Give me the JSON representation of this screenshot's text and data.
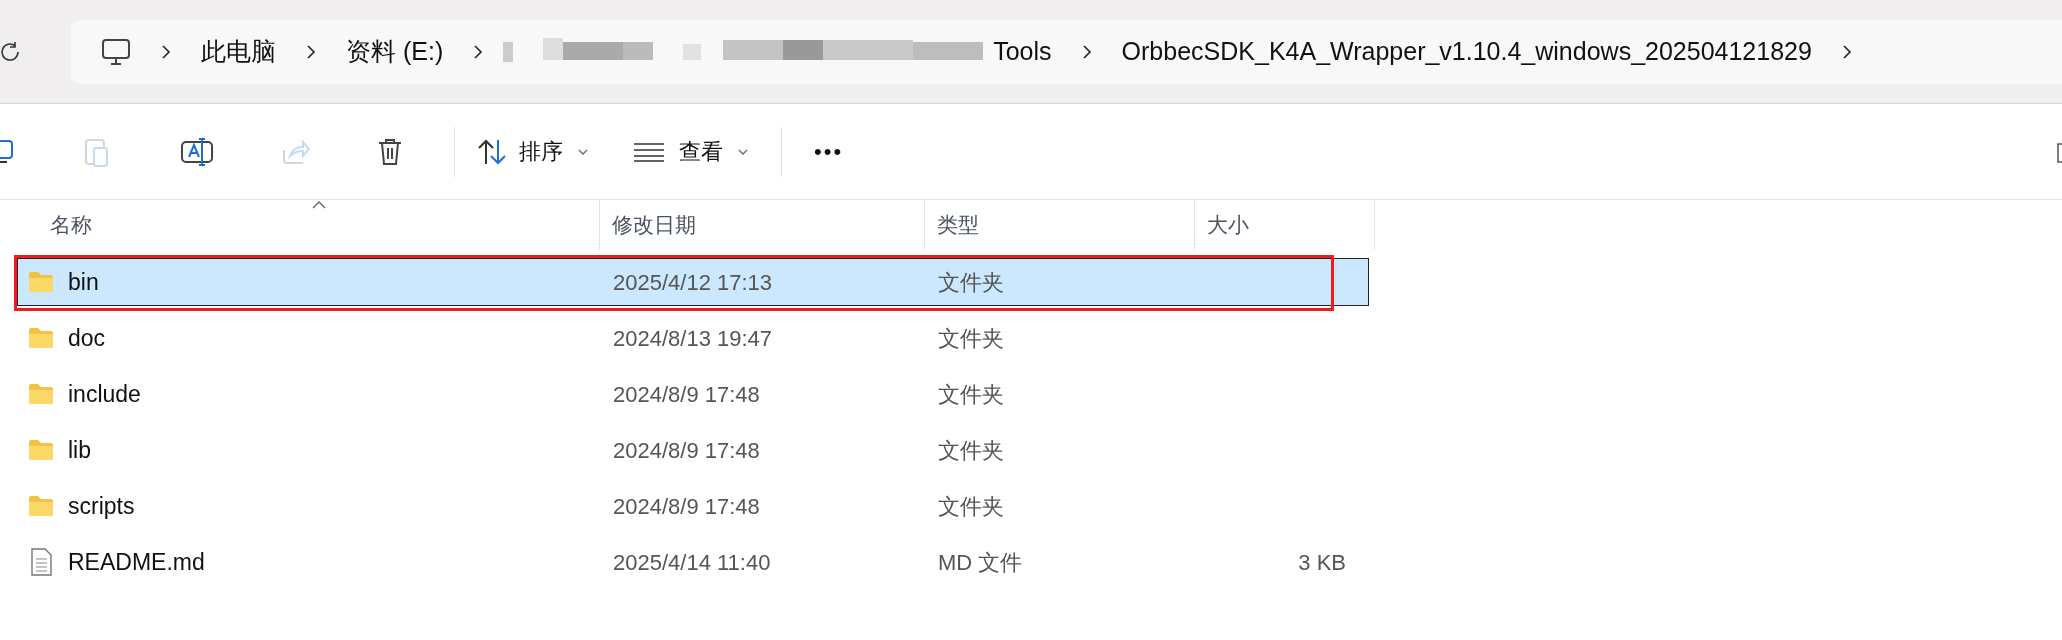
{
  "breadcrumb": {
    "items": [
      {
        "kind": "computer"
      },
      {
        "kind": "text",
        "label": "此电脑"
      },
      {
        "kind": "text",
        "label": "资料 (E:)"
      },
      {
        "kind": "redacted",
        "label": "Tools"
      },
      {
        "kind": "text",
        "label": "OrbbecSDK_K4A_Wrapper_v1.10.4_windows_202504121829"
      }
    ]
  },
  "toolbar": {
    "items": [
      {
        "kind": "copy",
        "disabled": false
      },
      {
        "kind": "paste",
        "disabled": true
      },
      {
        "kind": "rename",
        "disabled": false
      },
      {
        "kind": "share",
        "disabled": true
      },
      {
        "kind": "delete",
        "disabled": false
      },
      {
        "kind": "divider"
      },
      {
        "kind": "sort",
        "label": "排序"
      },
      {
        "kind": "view",
        "label": "查看"
      },
      {
        "kind": "divider"
      },
      {
        "kind": "more",
        "label": "•••"
      }
    ]
  },
  "table": {
    "columns": [
      {
        "label": "名称",
        "sorted": true
      },
      {
        "label": "修改日期",
        "sorted": false
      },
      {
        "label": "类型",
        "sorted": false
      },
      {
        "label": "大小",
        "sorted": false
      }
    ],
    "rows": [
      {
        "kind": "folder",
        "name": "bin",
        "modified": "2025/4/12 17:13",
        "type": "文件夹",
        "selected": true,
        "highlighted": true
      },
      {
        "kind": "folder",
        "name": "doc",
        "modified": "2024/8/13 19:47",
        "type": "文件夹",
        "selected": false,
        "highlighted": false
      },
      {
        "kind": "folder",
        "name": "include",
        "modified": "2024/8/9 17:48",
        "type": "文件夹",
        "selected": false,
        "highlighted": false
      },
      {
        "kind": "folder",
        "name": "lib",
        "modified": "2024/8/9 17:48",
        "type": "文件夹",
        "selected": false,
        "highlighted": false
      },
      {
        "kind": "folder",
        "name": "scripts",
        "modified": "2024/8/9 17:48",
        "type": "文件夹",
        "selected": false,
        "highlighted": false
      },
      {
        "kind": "file",
        "name": "README.md",
        "modified": "2025/4/14 11:40",
        "type": "MD 文件",
        "size": "3 KB",
        "selected": false,
        "highlighted": false
      }
    ]
  }
}
